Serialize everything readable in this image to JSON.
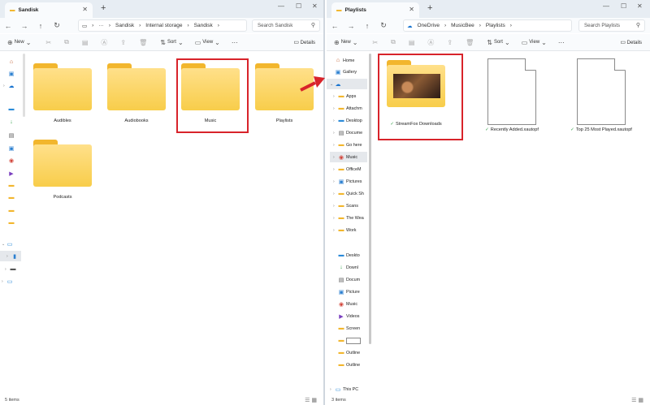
{
  "left": {
    "tab_title": "Sandisk",
    "breadcrumb": [
      "Sandisk",
      "Internal storage",
      "Sandisk"
    ],
    "search_placeholder": "Search Sandisk",
    "toolbar": {
      "new": "New",
      "sort": "Sort",
      "view": "View",
      "details": "Details"
    },
    "items": [
      "Audibles",
      "Audiobooks",
      "Music",
      "Playlists",
      "Podcasts"
    ],
    "status": "5 items"
  },
  "right": {
    "tab_title": "Playlists",
    "breadcrumb": [
      "OneDrive",
      "MusicBee",
      "Playlists"
    ],
    "search_placeholder": "Search Playlists",
    "toolbar": {
      "new": "New",
      "sort": "Sort",
      "view": "View",
      "details": "Details"
    },
    "sidebar": [
      "Home",
      "Gallery",
      "Apps",
      "Attachm",
      "Desktop",
      "Docume",
      "Go here",
      "Music",
      "OfficeM",
      "Pictures",
      "Quick Sh",
      "Scans",
      "The Wea",
      "Work",
      "Deskto",
      "Downl",
      "Docum",
      "Picture",
      "Music",
      "Videos",
      "Screen",
      "",
      "Outline",
      "Outline",
      "This PC"
    ],
    "files": [
      "StreamFox Downloads",
      "Recently Added.xautopf",
      "Top 25 Most Played.xautopf"
    ],
    "status": "3 items"
  },
  "colors": {
    "highlight": "#d8232a",
    "folder": "#f8cd4a",
    "check": "#2e9e44"
  }
}
